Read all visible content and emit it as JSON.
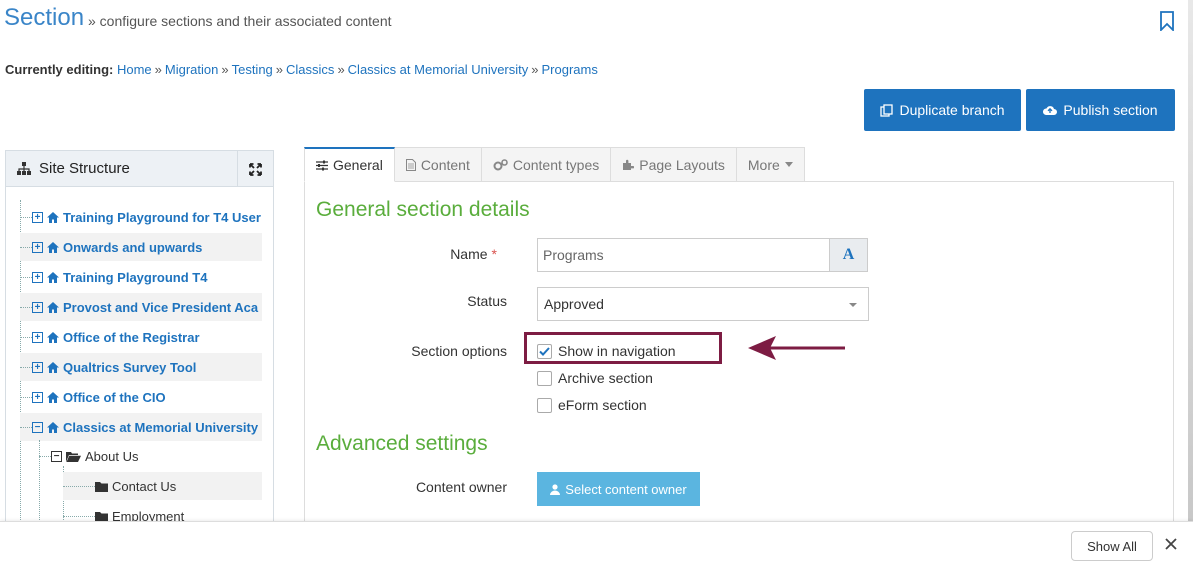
{
  "header": {
    "title": "Section",
    "subtitle": "» configure sections and their associated content"
  },
  "breadcrumb": {
    "label": "Currently editing:",
    "items": [
      "Home",
      "Migration",
      "Testing",
      "Classics",
      "Classics at Memorial University",
      "Programs"
    ],
    "separator": "»"
  },
  "actions": {
    "duplicate": "Duplicate branch",
    "publish": "Publish section"
  },
  "sidebar": {
    "title": "Site Structure",
    "items": [
      {
        "label": "Training Playground for T4 User",
        "expanded": false
      },
      {
        "label": "Onwards and upwards",
        "expanded": false
      },
      {
        "label": "Training Playground T4",
        "expanded": false
      },
      {
        "label": "Provost and Vice President Aca",
        "expanded": false
      },
      {
        "label": "Office of the Registrar",
        "expanded": false
      },
      {
        "label": "Qualtrics Survey Tool",
        "expanded": false
      },
      {
        "label": "Office of the CIO",
        "expanded": false
      },
      {
        "label": "Classics at Memorial University",
        "expanded": true
      }
    ],
    "children": [
      {
        "label": "About Us",
        "expanded": true
      },
      {
        "label": "Contact Us"
      },
      {
        "label": "Employment"
      }
    ]
  },
  "tabs": [
    {
      "label": "General",
      "active": true
    },
    {
      "label": "Content",
      "active": false
    },
    {
      "label": "Content types",
      "active": false
    },
    {
      "label": "Page Layouts",
      "active": false
    },
    {
      "label": "More",
      "active": false
    }
  ],
  "general": {
    "heading": "General section details",
    "name_label": "Name",
    "name_required": "*",
    "name_value": "Programs",
    "name_button": "A",
    "status_label": "Status",
    "status_value": "Approved",
    "options_label": "Section options",
    "options": [
      {
        "label": "Show in navigation",
        "checked": true
      },
      {
        "label": "Archive section",
        "checked": false
      },
      {
        "label": "eForm section",
        "checked": false
      }
    ]
  },
  "advanced": {
    "heading": "Advanced settings",
    "owner_label": "Content owner",
    "owner_button": "Select content owner"
  },
  "download_bar": {
    "show_all": "Show All"
  },
  "colors": {
    "brand_blue": "#1e73be",
    "heading_green": "#5aad3c",
    "highlight": "#7d1c43",
    "owner_button": "#5bb5e0"
  }
}
